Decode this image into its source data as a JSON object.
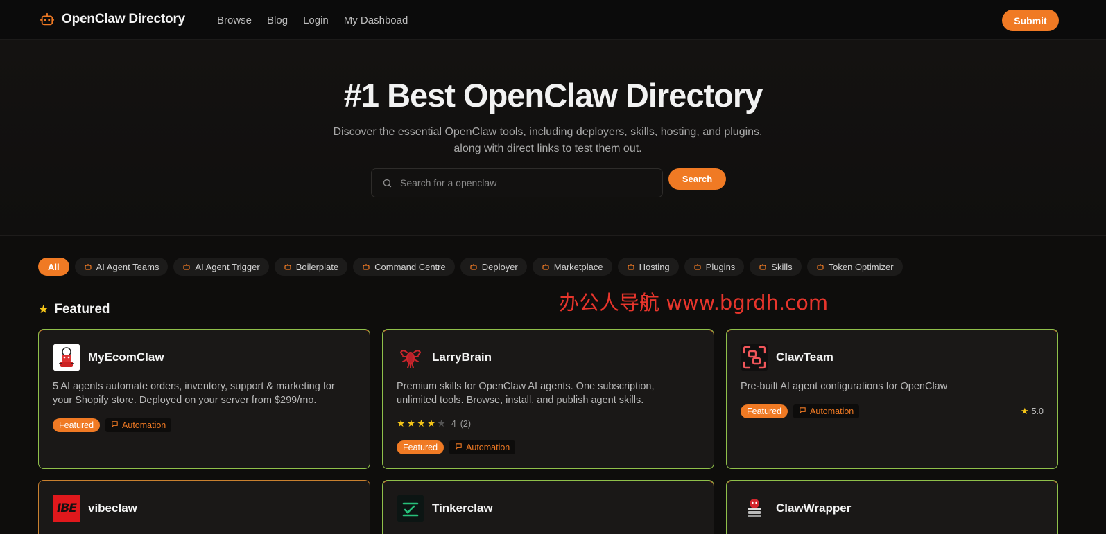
{
  "header": {
    "brand": "OpenClaw Directory",
    "nav": [
      "Browse",
      "Blog",
      "Login",
      "My Dashboad"
    ],
    "submit_label": "Submit"
  },
  "hero": {
    "title": "#1 Best OpenClaw Directory",
    "subtitle_line1": "Discover the essential OpenClaw tools, including deployers, skills, hosting, and plugins,",
    "subtitle_line2": "along with direct links to test them out.",
    "search_placeholder": "Search for a openclaw",
    "search_label": "Search"
  },
  "filters": [
    "All",
    "AI Agent Teams",
    "AI Agent Trigger",
    "Boilerplate",
    "Command Centre",
    "Deployer",
    "Marketplace",
    "Hosting",
    "Plugins",
    "Skills",
    "Token Optimizer"
  ],
  "section": {
    "title": "Featured"
  },
  "watermark": "办公人导航 www.bgrdh.com",
  "cards": [
    {
      "name": "MyEcomClaw",
      "desc_line1": "5 AI agents automate orders, inventory, support & marketing for",
      "desc_line2": "your Shopify store. Deployed on your server from $299/mo.",
      "tag_featured": "Featured",
      "tag_category": "Automation"
    },
    {
      "name": "LarryBrain",
      "desc_line1": "Premium skills for OpenClaw AI agents. One subscription,",
      "desc_line2": "unlimited tools. Browse, install, and publish agent skills.",
      "rating": 4,
      "rating_value": "4",
      "rating_count": "(2)",
      "tag_featured": "Featured",
      "tag_category": "Automation"
    },
    {
      "name": "ClawTeam",
      "desc_line1": "Pre-built AI agent configurations for OpenClaw",
      "score": "5.0",
      "tag_featured": "Featured",
      "tag_category": "Automation"
    },
    {
      "name": "vibeclaw",
      "logo_text": "IBE"
    },
    {
      "name": "Tinkerclaw"
    },
    {
      "name": "ClawWrapper"
    }
  ],
  "colors": {
    "accent": "#f07a24",
    "star": "#f5c518",
    "card_border_top": "#e06a2a",
    "card_border_bottom": "#7fc24a"
  }
}
